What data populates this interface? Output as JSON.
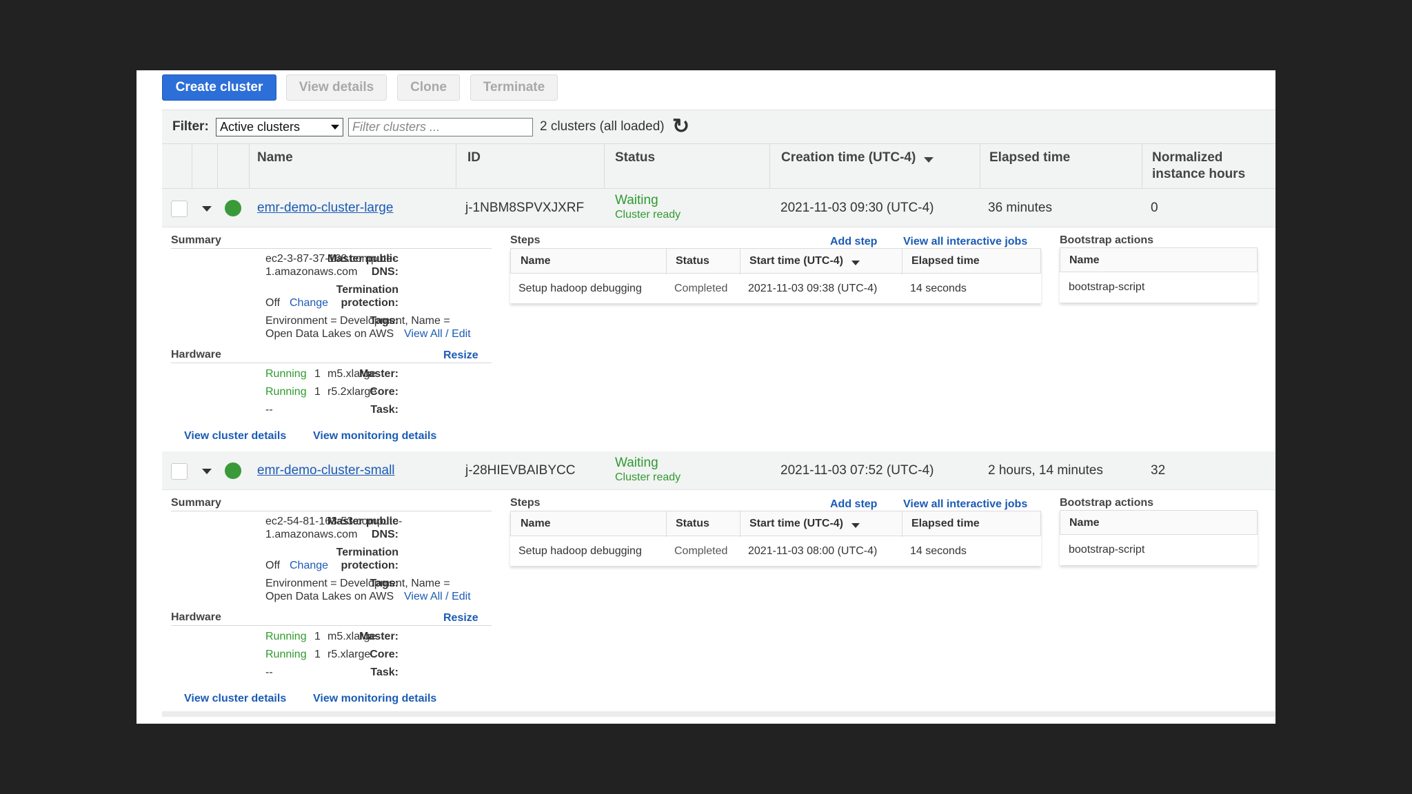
{
  "toolbar": {
    "create": "Create cluster",
    "view_details": "View details",
    "clone": "Clone",
    "terminate": "Terminate"
  },
  "filter": {
    "label": "Filter:",
    "selected": "Active clusters",
    "placeholder": "Filter clusters ...",
    "count": "2 clusters (all loaded)"
  },
  "columns": {
    "name": "Name",
    "id": "ID",
    "status": "Status",
    "creation": "Creation time (UTC-4)",
    "elapsed": "Elapsed time",
    "normalized_1": "Normalized",
    "normalized_2": "instance hours"
  },
  "labels": {
    "summary": "Summary",
    "master_dns_1": "Master public",
    "master_dns_2": "DNS:",
    "termination_1": "Termination",
    "termination_2": "protection:",
    "tags": "Tags:",
    "off": "Off",
    "change": "Change",
    "view_all_edit": "View All / Edit",
    "hardware": "Hardware",
    "resize": "Resize",
    "master": "Master:",
    "core": "Core:",
    "task": "Task:",
    "running": "Running",
    "task_value": "--",
    "steps": "Steps",
    "add_step": "Add step",
    "view_jobs": "View all interactive jobs",
    "step_name": "Name",
    "step_status": "Status",
    "step_start": "Start time (UTC-4)",
    "step_elapsed": "Elapsed time",
    "bootstrap": "Bootstrap actions",
    "bootstrap_name": "Name",
    "view_cluster": "View cluster details",
    "view_monitoring": "View monitoring details"
  },
  "clusters": [
    {
      "name": "emr-demo-cluster-large",
      "id": "j-1NBM8SPVXJXRF",
      "status": "Waiting",
      "status_sub": "Cluster ready",
      "creation": "2021-11-03 09:30 (UTC-4)",
      "elapsed": "36 minutes",
      "hours": "0",
      "dns_1": "ec2-3-87-37-168.compute-",
      "dns_2": "1.amazonaws.com",
      "tags_1": "Environment = Development, Name =",
      "tags_2": "Open Data Lakes on AWS",
      "master_count": "1",
      "master_type": "m5.xlarge",
      "core_count": "1",
      "core_type": "r5.2xlarge",
      "step": {
        "name": "Setup hadoop debugging",
        "status": "Completed",
        "start": "2021-11-03 09:38 (UTC-4)",
        "elapsed": "14 seconds"
      },
      "bootstrap": "bootstrap-script"
    },
    {
      "name": "emr-demo-cluster-small",
      "id": "j-28HIEVBAIBYCC",
      "status": "Waiting",
      "status_sub": "Cluster ready",
      "creation": "2021-11-03 07:52 (UTC-4)",
      "elapsed": "2 hours, 14 minutes",
      "hours": "32",
      "dns_1": "ec2-54-81-163-53.compute-",
      "dns_2": "1.amazonaws.com",
      "tags_1": "Environment = Development, Name =",
      "tags_2": "Open Data Lakes on AWS",
      "master_count": "1",
      "master_type": "m5.xlarge",
      "core_count": "1",
      "core_type": "r5.xlarge",
      "step": {
        "name": "Setup hadoop debugging",
        "status": "Completed",
        "start": "2021-11-03 08:00 (UTC-4)",
        "elapsed": "14 seconds"
      },
      "bootstrap": "bootstrap-script"
    }
  ]
}
